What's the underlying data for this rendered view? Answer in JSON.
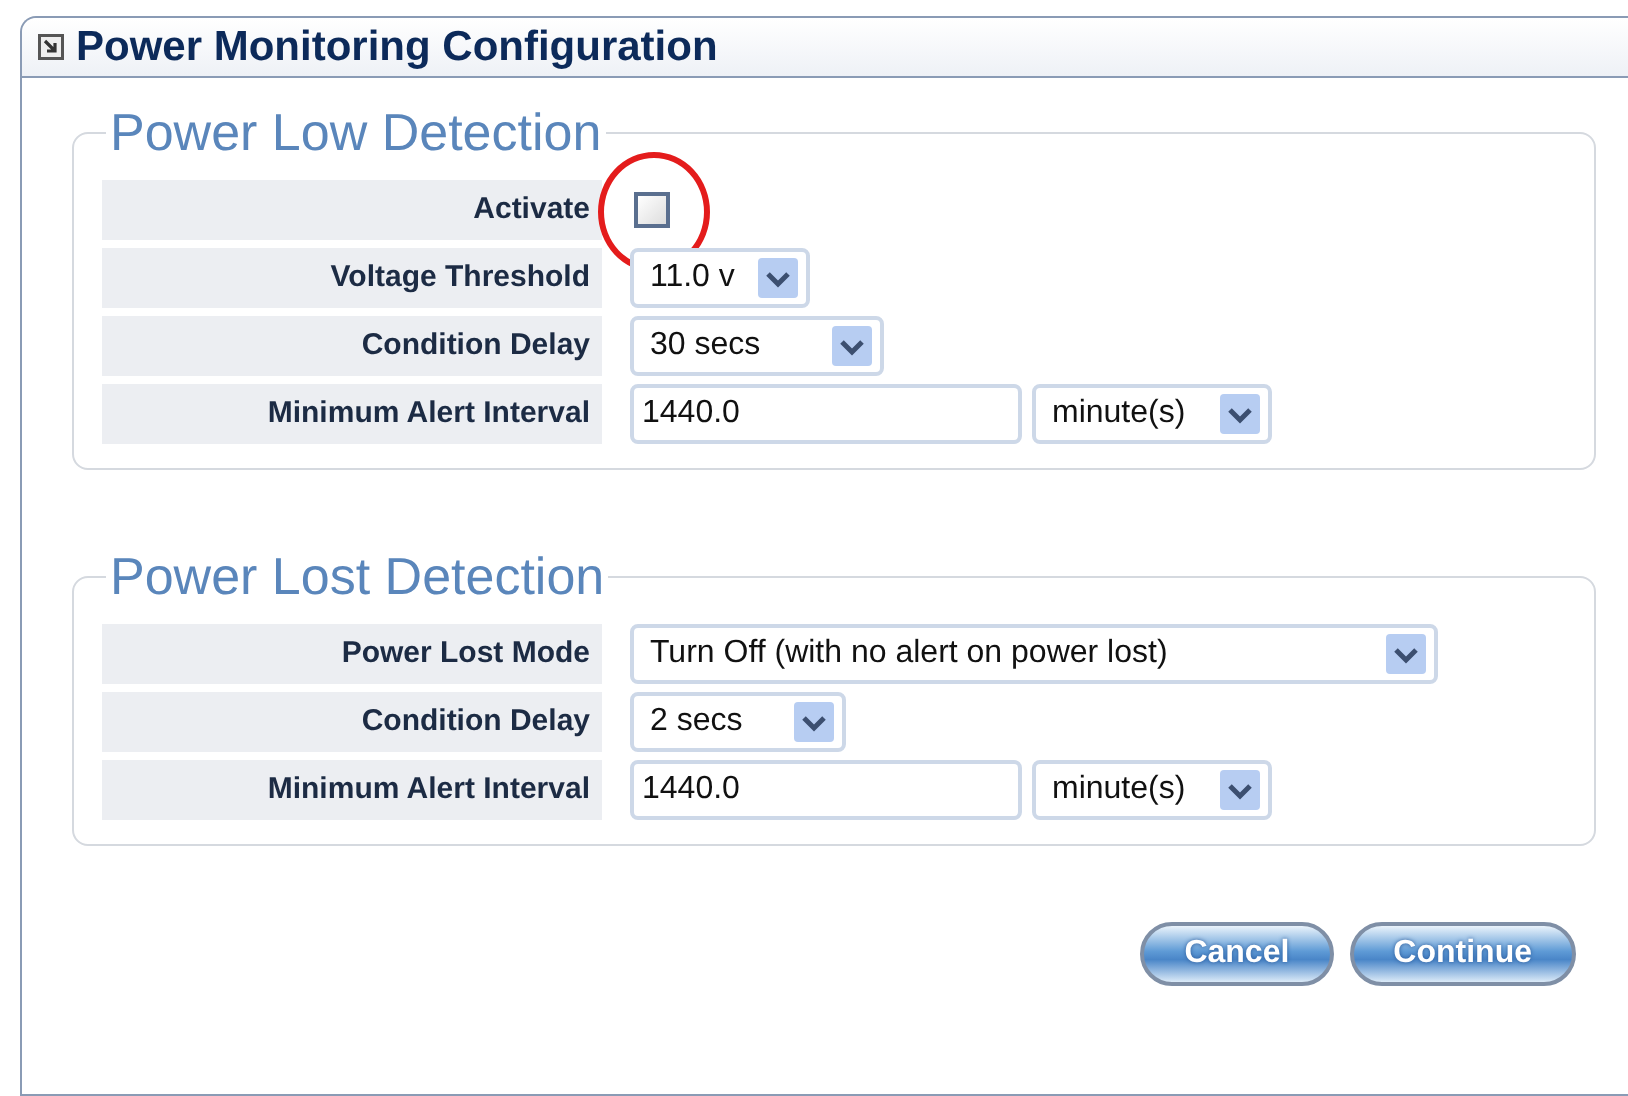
{
  "window": {
    "title": "Power Monitoring Configuration"
  },
  "sections": [
    {
      "title": "Power Low Detection",
      "rows": [
        {
          "kind": "checkbox",
          "label": "Activate",
          "checked": false,
          "highlighted": true
        },
        {
          "kind": "select",
          "label": "Voltage Threshold",
          "value": "11.0 v"
        },
        {
          "kind": "select",
          "label": "Condition Delay",
          "value": "30 secs"
        },
        {
          "kind": "input_select",
          "label": "Minimum Alert Interval",
          "value": "1440.0",
          "unit": "minute(s)"
        }
      ]
    },
    {
      "title": "Power Lost Detection",
      "rows": [
        {
          "kind": "select",
          "label": "Power Lost Mode",
          "value": "Turn Off (with no alert on power lost)"
        },
        {
          "kind": "select",
          "label": "Condition Delay",
          "value": "2 secs"
        },
        {
          "kind": "input_select",
          "label": "Minimum Alert Interval",
          "value": "1440.0",
          "unit": "minute(s)"
        }
      ]
    }
  ],
  "buttons": [
    "Cancel",
    "Continue"
  ]
}
